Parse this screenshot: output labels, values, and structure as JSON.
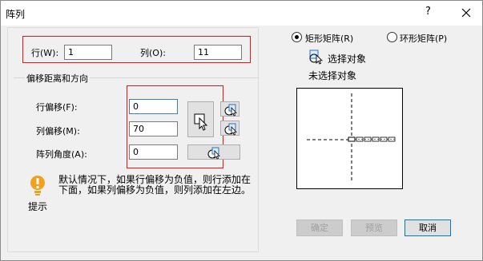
{
  "window": {
    "title": "阵列",
    "help_glyph": "?",
    "close_glyph": "✕"
  },
  "rows_cols": {
    "rows_label": "行(W):",
    "rows_value": "1",
    "cols_label": "列(O):",
    "cols_value": "11"
  },
  "offset": {
    "group_title": "偏移距离和方向",
    "row_offset_label": "行偏移(F):",
    "row_offset_value": "0",
    "col_offset_label": "列偏移(M):",
    "col_offset_value": "70",
    "angle_label": "阵列角度(A):",
    "angle_value": "0"
  },
  "hint": {
    "icon_label": "提示",
    "text": "默认情况下，如果行偏移为负值，则行添加在下面，如果列偏移为负值，则列添加在左边。"
  },
  "array_type": {
    "rect_label": "矩形矩阵(R)",
    "rect_selected": true,
    "polar_label": "环形矩阵(P)",
    "polar_selected": false
  },
  "selection": {
    "select_label": "选择对象",
    "status": "未选择对象"
  },
  "buttons": {
    "ok": "确定",
    "preview": "预览",
    "cancel": "取消"
  },
  "colors": {
    "highlight_border": "#e0161b",
    "focus_border": "#3c7fb1",
    "hint_icon": "#f2a11c"
  }
}
